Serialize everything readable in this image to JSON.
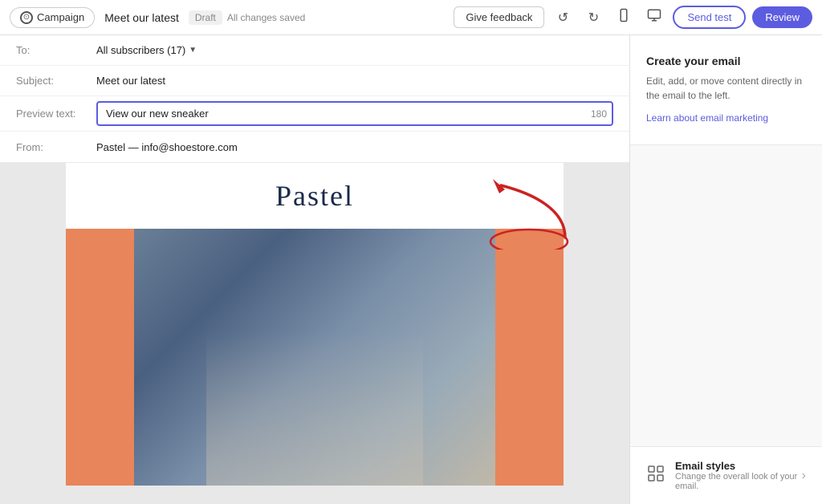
{
  "topbar": {
    "campaign_label": "Campaign",
    "tab_name": "Meet our latest",
    "draft_label": "Draft",
    "saved_label": "All changes saved",
    "feedback_label": "Give feedback",
    "send_test_label": "Send test",
    "review_label": "Review"
  },
  "email_meta": {
    "to_label": "To:",
    "to_value": "All subscribers (17)",
    "subject_label": "Subject:",
    "subject_value": "Meet our latest",
    "preview_label": "Preview text:",
    "preview_value": "View our new sneaker",
    "preview_char_count": "180",
    "from_label": "From:",
    "from_value": "Pastel — info@shoestore.com"
  },
  "email_preview": {
    "brand_name": "Pastel"
  },
  "right_panel": {
    "create_title": "Create your email",
    "create_desc": "Edit, add, or move content directly in the email to the left.",
    "learn_link": "Learn about email marketing",
    "styles_title": "Email styles",
    "styles_desc": "Change the overall look of your email."
  },
  "icons": {
    "campaign_icon": "⊙",
    "undo_icon": "↺",
    "redo_icon": "↻",
    "mobile_icon": "📱",
    "desktop_icon": "🖥"
  },
  "colors": {
    "accent": "#5c5ce0",
    "orange": "#e8855a",
    "dark_navy": "#1a2a4a"
  }
}
